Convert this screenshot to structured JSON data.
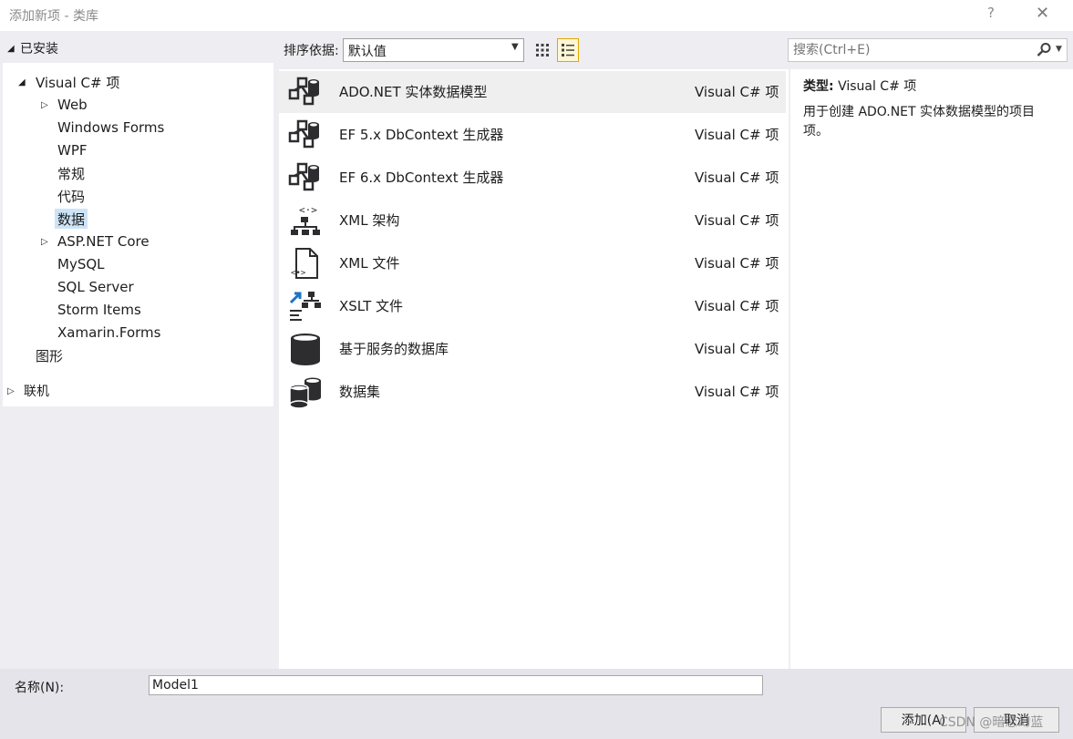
{
  "window": {
    "title": "添加新项 - 类库",
    "help": "?",
    "close": "✕"
  },
  "tree": {
    "installed": "已安装",
    "root": "Visual C# 项",
    "items": [
      "Web",
      "Windows Forms",
      "WPF",
      "常规",
      "代码",
      "数据",
      "ASP.NET Core",
      "MySQL",
      "SQL Server",
      "Storm Items",
      "Xamarin.Forms"
    ],
    "selected": "数据",
    "graphics": "图形",
    "online": "联机"
  },
  "sort": {
    "label": "排序依据:",
    "value": "默认值"
  },
  "search": {
    "placeholder": "搜索(Ctrl+E)"
  },
  "templates": [
    {
      "name": "ADO.NET 实体数据模型",
      "lang": "Visual C# 项",
      "icon": "entity-model-icon"
    },
    {
      "name": "EF 5.x DbContext 生成器",
      "lang": "Visual C# 项",
      "icon": "entity-model-icon"
    },
    {
      "name": "EF 6.x DbContext 生成器",
      "lang": "Visual C# 项",
      "icon": "entity-model-icon"
    },
    {
      "name": "XML 架构",
      "lang": "Visual C# 项",
      "icon": "xml-schema-icon"
    },
    {
      "name": "XML 文件",
      "lang": "Visual C# 项",
      "icon": "xml-file-icon"
    },
    {
      "name": "XSLT 文件",
      "lang": "Visual C# 项",
      "icon": "xslt-file-icon"
    },
    {
      "name": "基于服务的数据库",
      "lang": "Visual C# 项",
      "icon": "database-icon"
    },
    {
      "name": "数据集",
      "lang": "Visual C# 项",
      "icon": "dataset-icon"
    }
  ],
  "info": {
    "type_label": "类型:",
    "type_value": "Visual C# 项",
    "description": "用于创建 ADO.NET 实体数据模型的项目项。"
  },
  "bottom": {
    "name_label": "名称(N):",
    "name_value": "Model1",
    "add_button": "添加(A)",
    "cancel_button": "取消"
  },
  "watermark": "CSDN @暗恋幻蓝"
}
